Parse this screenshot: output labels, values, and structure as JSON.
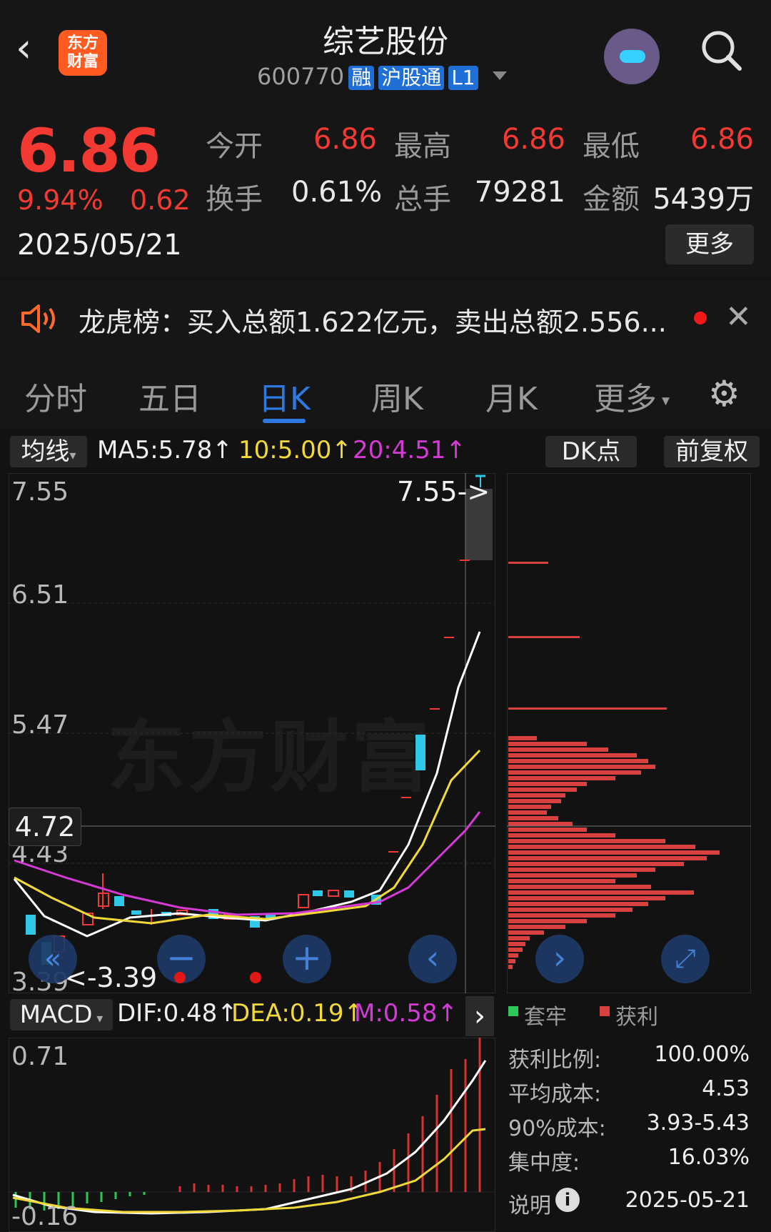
{
  "header": {
    "title": "综艺股份",
    "code": "600770",
    "tags": [
      "融",
      "沪股通",
      "L1"
    ],
    "logo_text": "东方\n财富"
  },
  "quote": {
    "price": "6.86",
    "change_pct": "9.94%",
    "change": "0.62",
    "date": "2025/05/21",
    "open_label": "今开",
    "open": "6.86",
    "high_label": "最高",
    "high": "6.86",
    "low_label": "最低",
    "low": "6.86",
    "turnover_label": "换手",
    "turnover": "0.61%",
    "volume_label": "总手",
    "volume": "79281",
    "amount_label": "金额",
    "amount": "5439万",
    "more_label": "更多"
  },
  "notice": {
    "text": "龙虎榜：买入总额1.622亿元，卖出总额2.556..."
  },
  "tabs": [
    "分时",
    "五日",
    "日K",
    "周K",
    "月K",
    "更多"
  ],
  "active_tab": 2,
  "ma_row": {
    "selector": "均线",
    "ma5": "MA5:5.78↑",
    "ma10": "10:5.00↑",
    "ma20": "20:4.51↑",
    "dk_btn": "DK点",
    "adjust_btn": "前复权"
  },
  "kchart": {
    "y_labels": [
      "7.55",
      "6.51",
      "5.47",
      "4.43",
      "3.39"
    ],
    "crosshair_value": "4.72",
    "max_marker": "7.55->",
    "min_marker": "<-3.39",
    "watermark": "东方财富"
  },
  "macd": {
    "selector": "MACD",
    "dif": "DIF:0.48↑",
    "dea": "DEA:0.19↑",
    "m": "M:0.58↑",
    "y_top": "0.71",
    "y_bottom": "-0.16"
  },
  "chips": {
    "legend_trapped": "套牢",
    "legend_profit": "获利",
    "profit_ratio_label": "获利比例:",
    "profit_ratio": "100.00%",
    "avg_cost_label": "平均成本:",
    "avg_cost": "4.53",
    "cost90_label": "90%成本:",
    "cost90": "3.93-5.43",
    "concentration_label": "集中度:",
    "concentration": "16.03%",
    "explain_label": "说明",
    "date": "2025-05-21"
  },
  "colors": {
    "up": "#f23a32",
    "down": "#2ec8e8",
    "accent": "#2f7ae0"
  }
}
